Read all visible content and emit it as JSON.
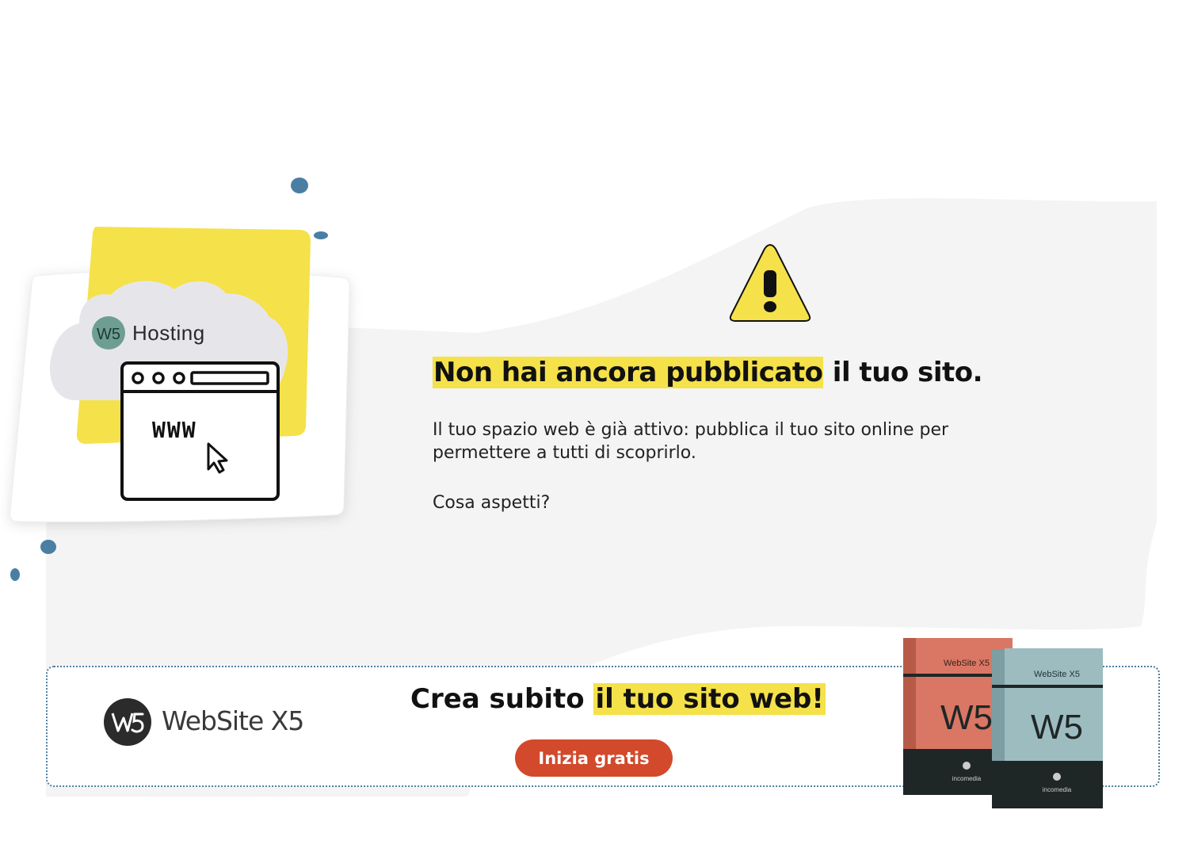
{
  "hero": {
    "hosting_label": "Hosting",
    "logo_mark": "W5",
    "browser_text": "WWW",
    "icons": [
      "cloud-icon",
      "browser-window-icon",
      "cursor-icon"
    ]
  },
  "warning": {
    "icon": "warning-triangle-icon"
  },
  "message": {
    "headline_highlight": "Non hai ancora pubblicato",
    "headline_rest": " il tuo sito.",
    "body": "Il tuo spazio web è già attivo: pubblica il tuo sito online per permettere a tutti di scoprirlo.",
    "question": "Cosa aspetti?"
  },
  "banner": {
    "brand_name": "WebSite X5",
    "title_plain": "Crea subito ",
    "title_highlight": "il tuo sito web!",
    "cta_label": "Inizia gratis",
    "boxes": {
      "box_left": {
        "title": "WebSite X5",
        "logo": "W5",
        "brand": "incomedia"
      },
      "box_right": {
        "title": "WebSite X5",
        "logo": "W5",
        "brand": "incomedia"
      }
    }
  },
  "colors": {
    "accent_yellow": "#f5e14a",
    "cta_red": "#d2492b",
    "blob_grey": "#f4f4f4",
    "dot_blue": "#4a7fa3",
    "brand_teal": "#6e9e92",
    "box_red": "#d97764",
    "box_teal": "#9cbcc0"
  }
}
